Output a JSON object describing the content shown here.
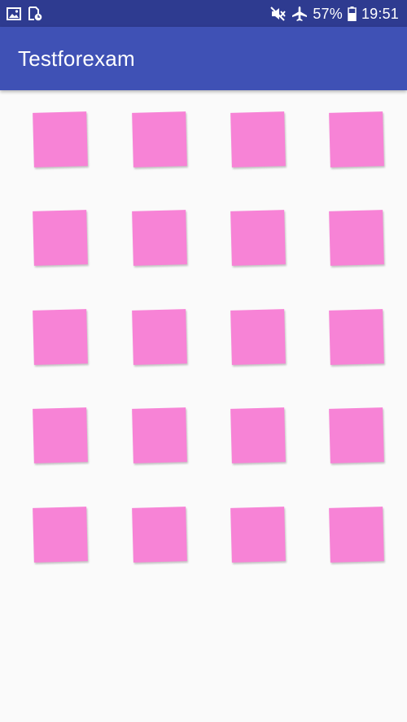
{
  "status_bar": {
    "battery": "57%",
    "time": "19:51",
    "left_icons": [
      "image-icon",
      "clock-file-icon"
    ],
    "right_icons": [
      "mute-icon",
      "airplane-icon",
      "battery-icon"
    ]
  },
  "app_bar": {
    "title": "Testforexam"
  },
  "grid": {
    "rows": 5,
    "columns": 4,
    "tile_color": "#f783d6"
  },
  "colors": {
    "status_bar": "#2e3b90",
    "app_bar": "#3f51b5",
    "background": "#fafafa"
  }
}
